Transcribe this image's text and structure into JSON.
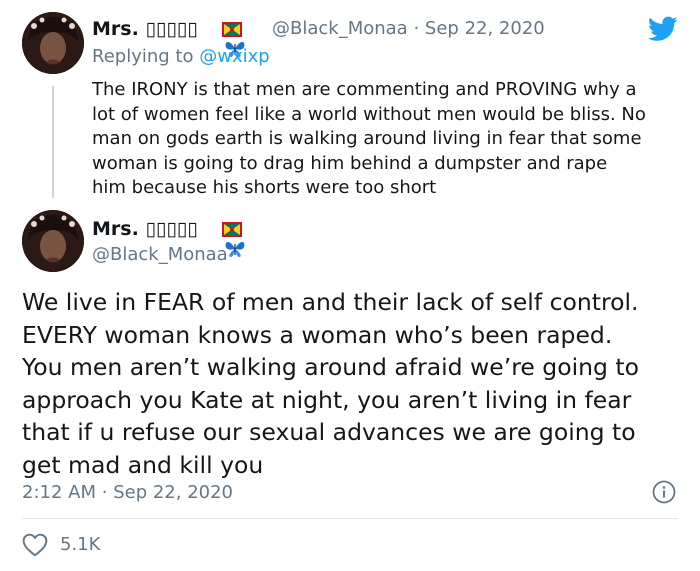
{
  "reply_tweet": {
    "display_name": "Mrs.",
    "name_glyphs": "▯▯▯▯▯",
    "handle": "@Black_Monaa",
    "separator": "·",
    "date": "Sep 22, 2020",
    "replying_prefix": "Replying to",
    "replying_to": "@wxixp",
    "lines": [
      "The IRONY is that men are commenting and PROVING why a",
      "lot of women feel like a world without men would be bliss. No",
      "man on gods earth is walking around living in fear that some",
      "woman is going to drag him behind a dumpster and rape",
      "him because his shorts were too short"
    ]
  },
  "main_tweet": {
    "display_name": "Mrs.",
    "name_glyphs": "▯▯▯▯▯",
    "handle": "@Black_Monaa",
    "lines": [
      "We live in FEAR of men and their lack of self control.",
      "EVERY woman knows a woman who’s been raped.",
      "You men aren’t walking around afraid we’re going to",
      "approach you Kate at night, you aren’t living in fear",
      "that if u refuse our sexual advances we are going to",
      "get mad and kill you"
    ],
    "time": "2:12 AM",
    "separator": "·",
    "date": "Sep 22, 2020",
    "likes": "5.1K"
  },
  "icons": {
    "platform": "twitter-bird-icon",
    "flag": "grenada-flag-icon",
    "emoji": "blue-butterfly-icon",
    "info": "info-icon",
    "like": "heart-icon"
  },
  "colors": {
    "twitter_blue": "#1da1f2",
    "text": "#14171a",
    "secondary_text": "#657786",
    "divider": "#e1e8ed"
  }
}
